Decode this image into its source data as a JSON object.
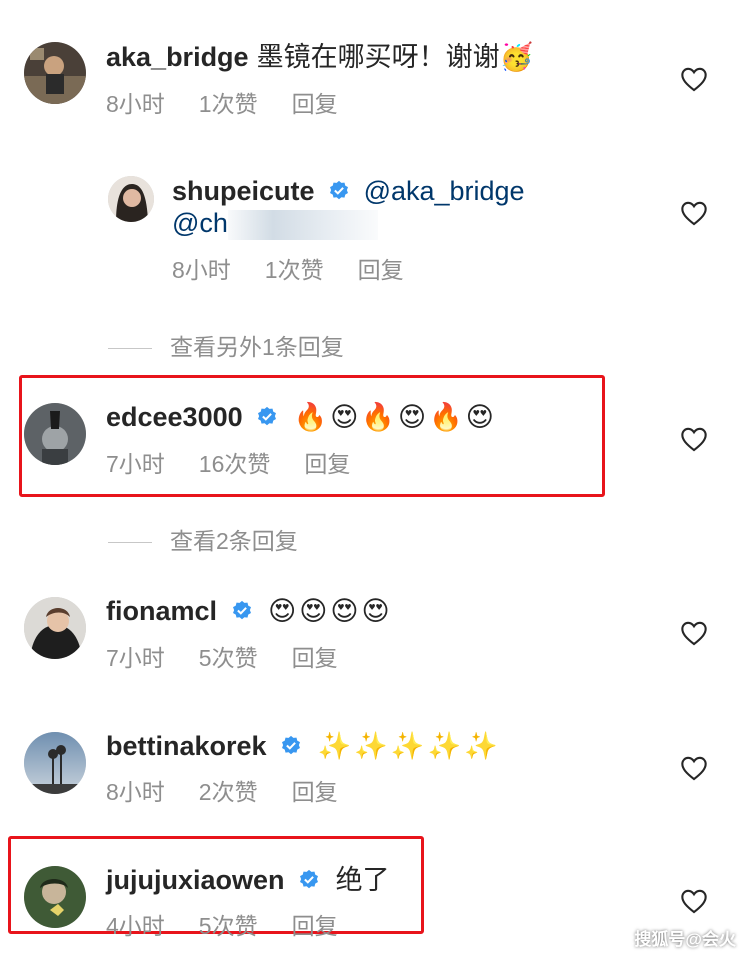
{
  "comments": [
    {
      "username": "aka_bridge",
      "text": "墨镜在哪买呀！谢谢",
      "emoji": "🥳",
      "time": "8小时",
      "likes": "1次赞",
      "reply": "回复"
    },
    {
      "username": "shupeicute",
      "mention": "@aka_bridge",
      "mention2": "@ch",
      "time": "8小时",
      "likes": "1次赞",
      "reply": "回复"
    },
    {
      "username": "edcee3000",
      "emojis": "🔥😍🔥😍🔥😍",
      "time": "7小时",
      "likes": "16次赞",
      "reply": "回复"
    },
    {
      "username": "fionamcl",
      "emojis": "😍😍😍😍",
      "time": "7小时",
      "likes": "5次赞",
      "reply": "回复"
    },
    {
      "username": "bettinakorek",
      "emojis": "✨✨✨✨✨",
      "time": "8小时",
      "likes": "2次赞",
      "reply": "回复"
    },
    {
      "username": "jujujuxiaowen",
      "text": "绝了",
      "time": "4小时",
      "likes": "5次赞",
      "reply": "回复"
    }
  ],
  "view_more": [
    "查看另外1条回复",
    "查看2条回复"
  ],
  "watermark": "搜狐号@会火",
  "colors": {
    "highlight": "#e8141b",
    "verified": "#3897f0",
    "meta": "#8e8e8e",
    "mention": "#00376b"
  }
}
